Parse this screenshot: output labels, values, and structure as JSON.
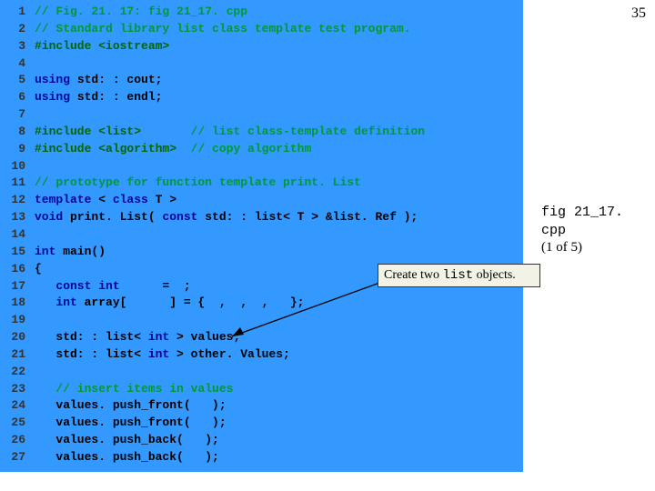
{
  "slide_number": "35",
  "side_note": {
    "file": "fig 21_17. cpp",
    "part": "(1 of 5)"
  },
  "callout": {
    "text_pre": "Create two ",
    "code": "list",
    "text_post": " objects."
  },
  "lines": [
    {
      "n": "1",
      "segs": [
        {
          "cls": "comment",
          "t": "// Fig. 21. 17: fig 21_17. cpp"
        }
      ]
    },
    {
      "n": "2",
      "segs": [
        {
          "cls": "comment",
          "t": "// Standard library list class template test program."
        }
      ]
    },
    {
      "n": "3",
      "segs": [
        {
          "cls": "preproc",
          "t": "#include <iostream>"
        }
      ]
    },
    {
      "n": "4",
      "segs": [
        {
          "cls": "code",
          "t": ""
        }
      ]
    },
    {
      "n": "5",
      "segs": [
        {
          "cls": "keyword",
          "t": "using "
        },
        {
          "cls": "code",
          "t": "std: : cout;"
        }
      ]
    },
    {
      "n": "6",
      "segs": [
        {
          "cls": "keyword",
          "t": "using "
        },
        {
          "cls": "code",
          "t": "std: : endl;"
        }
      ]
    },
    {
      "n": "7",
      "segs": [
        {
          "cls": "code",
          "t": ""
        }
      ]
    },
    {
      "n": "8",
      "segs": [
        {
          "cls": "preproc",
          "t": "#include <list>       "
        },
        {
          "cls": "comment",
          "t": "// list class-template definition"
        }
      ]
    },
    {
      "n": "9",
      "segs": [
        {
          "cls": "preproc",
          "t": "#include <algorithm>  "
        },
        {
          "cls": "comment",
          "t": "// copy algorithm"
        }
      ]
    },
    {
      "n": "10",
      "segs": [
        {
          "cls": "code",
          "t": ""
        }
      ]
    },
    {
      "n": "11",
      "segs": [
        {
          "cls": "comment",
          "t": "// prototype for function template print. List"
        }
      ]
    },
    {
      "n": "12",
      "segs": [
        {
          "cls": "keyword",
          "t": "template "
        },
        {
          "cls": "code",
          "t": "< "
        },
        {
          "cls": "keyword",
          "t": "class"
        },
        {
          "cls": "code",
          "t": " T >"
        }
      ]
    },
    {
      "n": "13",
      "segs": [
        {
          "cls": "keyword",
          "t": "void"
        },
        {
          "cls": "code",
          "t": " print. List( "
        },
        {
          "cls": "keyword",
          "t": "const"
        },
        {
          "cls": "code",
          "t": " std: : list< T > &list. Ref );"
        }
      ]
    },
    {
      "n": "14",
      "segs": [
        {
          "cls": "code",
          "t": ""
        }
      ]
    },
    {
      "n": "15",
      "segs": [
        {
          "cls": "keyword",
          "t": "int"
        },
        {
          "cls": "code",
          "t": " main()"
        }
      ]
    },
    {
      "n": "16",
      "segs": [
        {
          "cls": "code",
          "t": "{"
        }
      ]
    },
    {
      "n": "17",
      "segs": [
        {
          "cls": "code",
          "t": "   "
        },
        {
          "cls": "keyword",
          "t": "const int"
        },
        {
          "cls": "code",
          "t": "      =  ;"
        }
      ]
    },
    {
      "n": "18",
      "segs": [
        {
          "cls": "code",
          "t": "   "
        },
        {
          "cls": "keyword",
          "t": "int"
        },
        {
          "cls": "code",
          "t": " array[      ] = {  ,  ,  ,   };"
        }
      ]
    },
    {
      "n": "19",
      "segs": [
        {
          "cls": "code",
          "t": ""
        }
      ]
    },
    {
      "n": "20",
      "segs": [
        {
          "cls": "code",
          "t": "   std: : list< "
        },
        {
          "cls": "keyword",
          "t": "int"
        },
        {
          "cls": "code",
          "t": " > values;"
        }
      ]
    },
    {
      "n": "21",
      "segs": [
        {
          "cls": "code",
          "t": "   std: : list< "
        },
        {
          "cls": "keyword",
          "t": "int"
        },
        {
          "cls": "code",
          "t": " > other. Values;"
        }
      ]
    },
    {
      "n": "22",
      "segs": [
        {
          "cls": "code",
          "t": ""
        }
      ]
    },
    {
      "n": "23",
      "segs": [
        {
          "cls": "code",
          "t": "   "
        },
        {
          "cls": "comment",
          "t": "// insert items in values"
        }
      ]
    },
    {
      "n": "24",
      "segs": [
        {
          "cls": "code",
          "t": "   values. push_front(   );"
        }
      ]
    },
    {
      "n": "25",
      "segs": [
        {
          "cls": "code",
          "t": "   values. push_front(   );"
        }
      ]
    },
    {
      "n": "26",
      "segs": [
        {
          "cls": "code",
          "t": "   values. push_back(   );"
        }
      ]
    },
    {
      "n": "27",
      "segs": [
        {
          "cls": "code",
          "t": "   values. push_back(   );"
        }
      ]
    }
  ]
}
